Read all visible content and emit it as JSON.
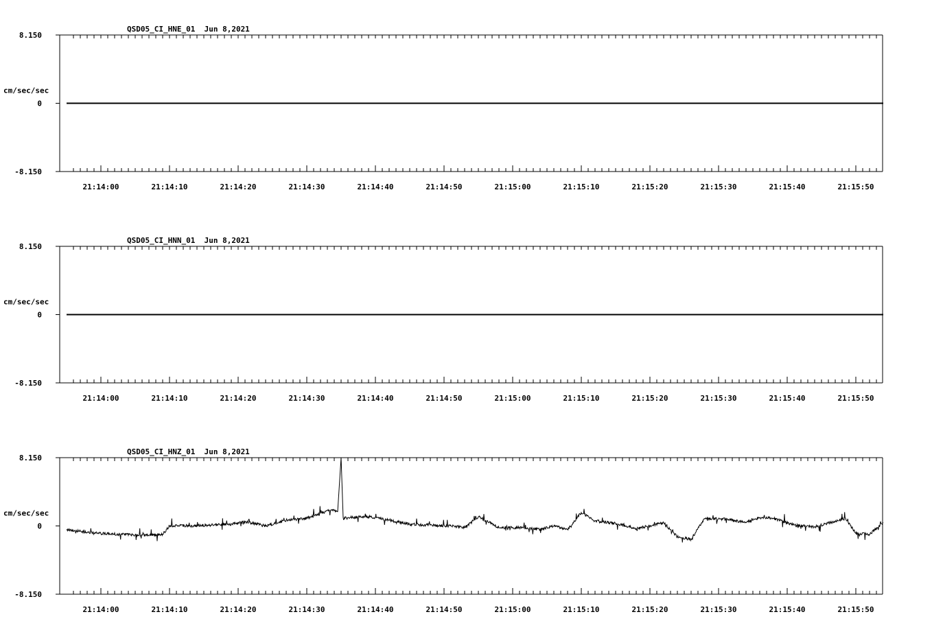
{
  "chart_data": [
    {
      "type": "line",
      "title": "QSD05_CI_HNE_01  Jun 8,2021",
      "ylabel": "cm/sec/sec",
      "ylim": [
        -8.15,
        8.15
      ],
      "y_tick_labels": [
        "8.150",
        "0",
        "-8.150"
      ],
      "x_tick_labels": [
        "21:14:00",
        "21:14:10",
        "21:14:20",
        "21:14:30",
        "21:14:40",
        "21:14:50",
        "21:15:00",
        "21:15:10",
        "21:15:20",
        "21:15:30",
        "21:15:40",
        "21:15:50"
      ],
      "series": [
        {
          "x": [
            "21:13:55",
            "21:15:54"
          ],
          "values": [
            0,
            0
          ]
        }
      ]
    },
    {
      "type": "line",
      "title": "QSD05_CI_HNN_01  Jun 8,2021",
      "ylabel": "cm/sec/sec",
      "ylim": [
        -8.15,
        8.15
      ],
      "y_tick_labels": [
        "8.150",
        "0",
        "-8.150"
      ],
      "x_tick_labels": [
        "21:14:00",
        "21:14:10",
        "21:14:20",
        "21:14:30",
        "21:14:40",
        "21:14:50",
        "21:15:00",
        "21:15:10",
        "21:15:20",
        "21:15:30",
        "21:15:40",
        "21:15:50"
      ],
      "series": [
        {
          "x": [
            "21:13:55",
            "21:15:54"
          ],
          "values": [
            0,
            0
          ]
        }
      ]
    },
    {
      "type": "line",
      "title": "QSD05_CI_HNZ_01  Jun 8,2021",
      "ylabel": "cm/sec/sec",
      "ylim": [
        -8.15,
        8.15
      ],
      "y_tick_labels": [
        "8.150",
        "0",
        "-8.150"
      ],
      "x_tick_labels": [
        "21:14:00",
        "21:14:10",
        "21:14:20",
        "21:14:30",
        "21:14:40",
        "21:14:50",
        "21:15:00",
        "21:15:10",
        "21:15:20",
        "21:15:30",
        "21:15:40",
        "21:15:50"
      ],
      "series": [
        {
          "x": [
            "21:13:55",
            "21:13:58",
            "21:14:00",
            "21:14:03",
            "21:14:06",
            "21:14:09",
            "21:14:10",
            "21:14:13",
            "21:14:16",
            "21:14:19",
            "21:14:21",
            "21:14:24",
            "21:14:27",
            "21:14:30",
            "21:14:32",
            "21:14:33.5",
            "21:14:34.5",
            "21:14:35",
            "21:14:35.3",
            "21:14:36",
            "21:14:39",
            "21:14:42",
            "21:14:45",
            "21:14:48",
            "21:14:51",
            "21:14:53",
            "21:14:55",
            "21:14:58",
            "21:15:01",
            "21:15:04",
            "21:15:06",
            "21:15:08",
            "21:15:10",
            "21:15:12",
            "21:15:15",
            "21:15:18",
            "21:15:20",
            "21:15:22",
            "21:15:24",
            "21:15:26",
            "21:15:28",
            "21:15:31",
            "21:15:34",
            "21:15:36",
            "21:15:38",
            "21:15:41",
            "21:15:44",
            "21:15:47",
            "21:15:48.5",
            "21:15:50",
            "21:15:52",
            "21:15:54"
          ],
          "values": [
            -0.4,
            -0.8,
            -0.9,
            -1.0,
            -1.1,
            -1.0,
            0.0,
            0.0,
            0.1,
            0.2,
            0.5,
            0.0,
            0.7,
            0.9,
            1.5,
            1.9,
            1.7,
            8.15,
            1.0,
            1.0,
            1.1,
            0.7,
            0.2,
            0.1,
            0.0,
            -0.2,
            1.1,
            -0.2,
            -0.2,
            -0.4,
            0.0,
            -0.4,
            1.6,
            0.6,
            0.3,
            -0.3,
            0.0,
            0.4,
            -1.3,
            -1.6,
            0.9,
            0.8,
            0.4,
            1.0,
            0.9,
            0.1,
            -0.1,
            0.5,
            0.9,
            -0.9,
            -1.0,
            0.4
          ]
        }
      ]
    }
  ]
}
